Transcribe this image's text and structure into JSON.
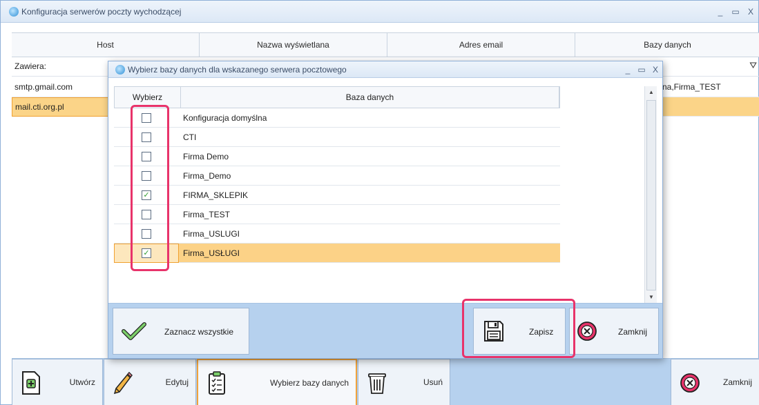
{
  "main_window": {
    "title": "Konfiguracja serwerów poczty wychodzącej",
    "controls": {
      "minimize": "_",
      "maximize": "▭",
      "close": "X"
    },
    "columns": [
      "Host",
      "Nazwa wyświetlana",
      "Adres email",
      "Bazy danych"
    ],
    "filter_label": "Zawiera:",
    "rows": [
      {
        "host": "smtp.gmail.com",
        "bazy_fragment": "na,Firma_TEST"
      },
      {
        "host": "mail.cti.org.pl",
        "bazy_fragment": ""
      }
    ],
    "toolbar": {
      "create": "Utwórz",
      "edit": "Edytuj",
      "choose_db": "Wybierz bazy danych",
      "delete": "Usuń",
      "close": "Zamknij"
    }
  },
  "dialog": {
    "title": "Wybierz bazy danych dla wskazanego serwera pocztowego",
    "controls": {
      "minimize": "_",
      "maximize": "▭",
      "close": "X"
    },
    "columns": [
      "Wybierz",
      "Baza danych"
    ],
    "rows": [
      {
        "name": "Konfiguracja domyślna",
        "checked": false
      },
      {
        "name": "CTI",
        "checked": false
      },
      {
        "name": "Firma Demo",
        "checked": false
      },
      {
        "name": "Firma_Demo",
        "checked": false
      },
      {
        "name": "FIRMA_SKLEPIK",
        "checked": true
      },
      {
        "name": "Firma_TEST",
        "checked": false
      },
      {
        "name": "Firma_USLUGI",
        "checked": false
      },
      {
        "name": "Firma_USŁUGI",
        "checked": true
      }
    ],
    "buttons": {
      "select_all": "Zaznacz wszystkie",
      "save": "Zapisz",
      "close": "Zamknij"
    }
  },
  "colors": {
    "accent_highlight": "#e8336a",
    "selection": "#fcd287",
    "toolbar_bg": "#b6d1ee"
  }
}
